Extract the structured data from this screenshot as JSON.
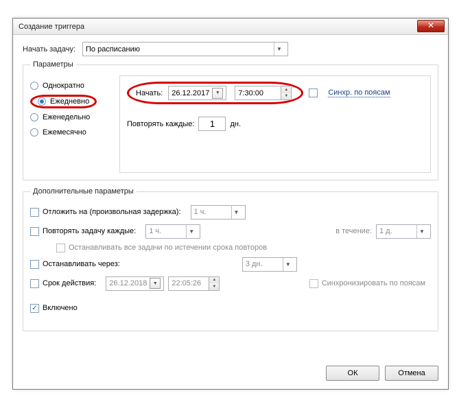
{
  "title": "Создание триггера",
  "beginTask": {
    "label": "Начать задачу:",
    "value": "По расписанию"
  },
  "params": {
    "legend": "Параметры",
    "radios": {
      "once": "Однократно",
      "daily": "Ежедневно",
      "weekly": "Еженедельно",
      "monthly": "Ежемесячно"
    },
    "startLabel": "Начать:",
    "date": "26.12.2017",
    "time": "7:30:00",
    "syncTz": "Синхр. по поясам",
    "repeatLabel": "Повторять каждые:",
    "repeatValue": "1",
    "repeatUnit": "дн."
  },
  "adv": {
    "legend": "Дополнительные параметры",
    "delay": {
      "label": "Отложить на (произвольная задержка):",
      "value": "1 ч."
    },
    "repeat": {
      "label": "Повторять задачу каждые:",
      "value": "1 ч.",
      "durLabel": "в течение:",
      "durValue": "1 д."
    },
    "stopAll": "Останавливать все задачи по истечении срока повторов",
    "stopAfter": {
      "label": "Останавливать через:",
      "value": "3 дн."
    },
    "expire": {
      "label": "Срок действия:",
      "date": "26.12.2018",
      "time": "22:05:26",
      "tz": "Синхронизировать по поясам"
    },
    "enabled": "Включено"
  },
  "ok": "ОК",
  "cancel": "Отмена"
}
